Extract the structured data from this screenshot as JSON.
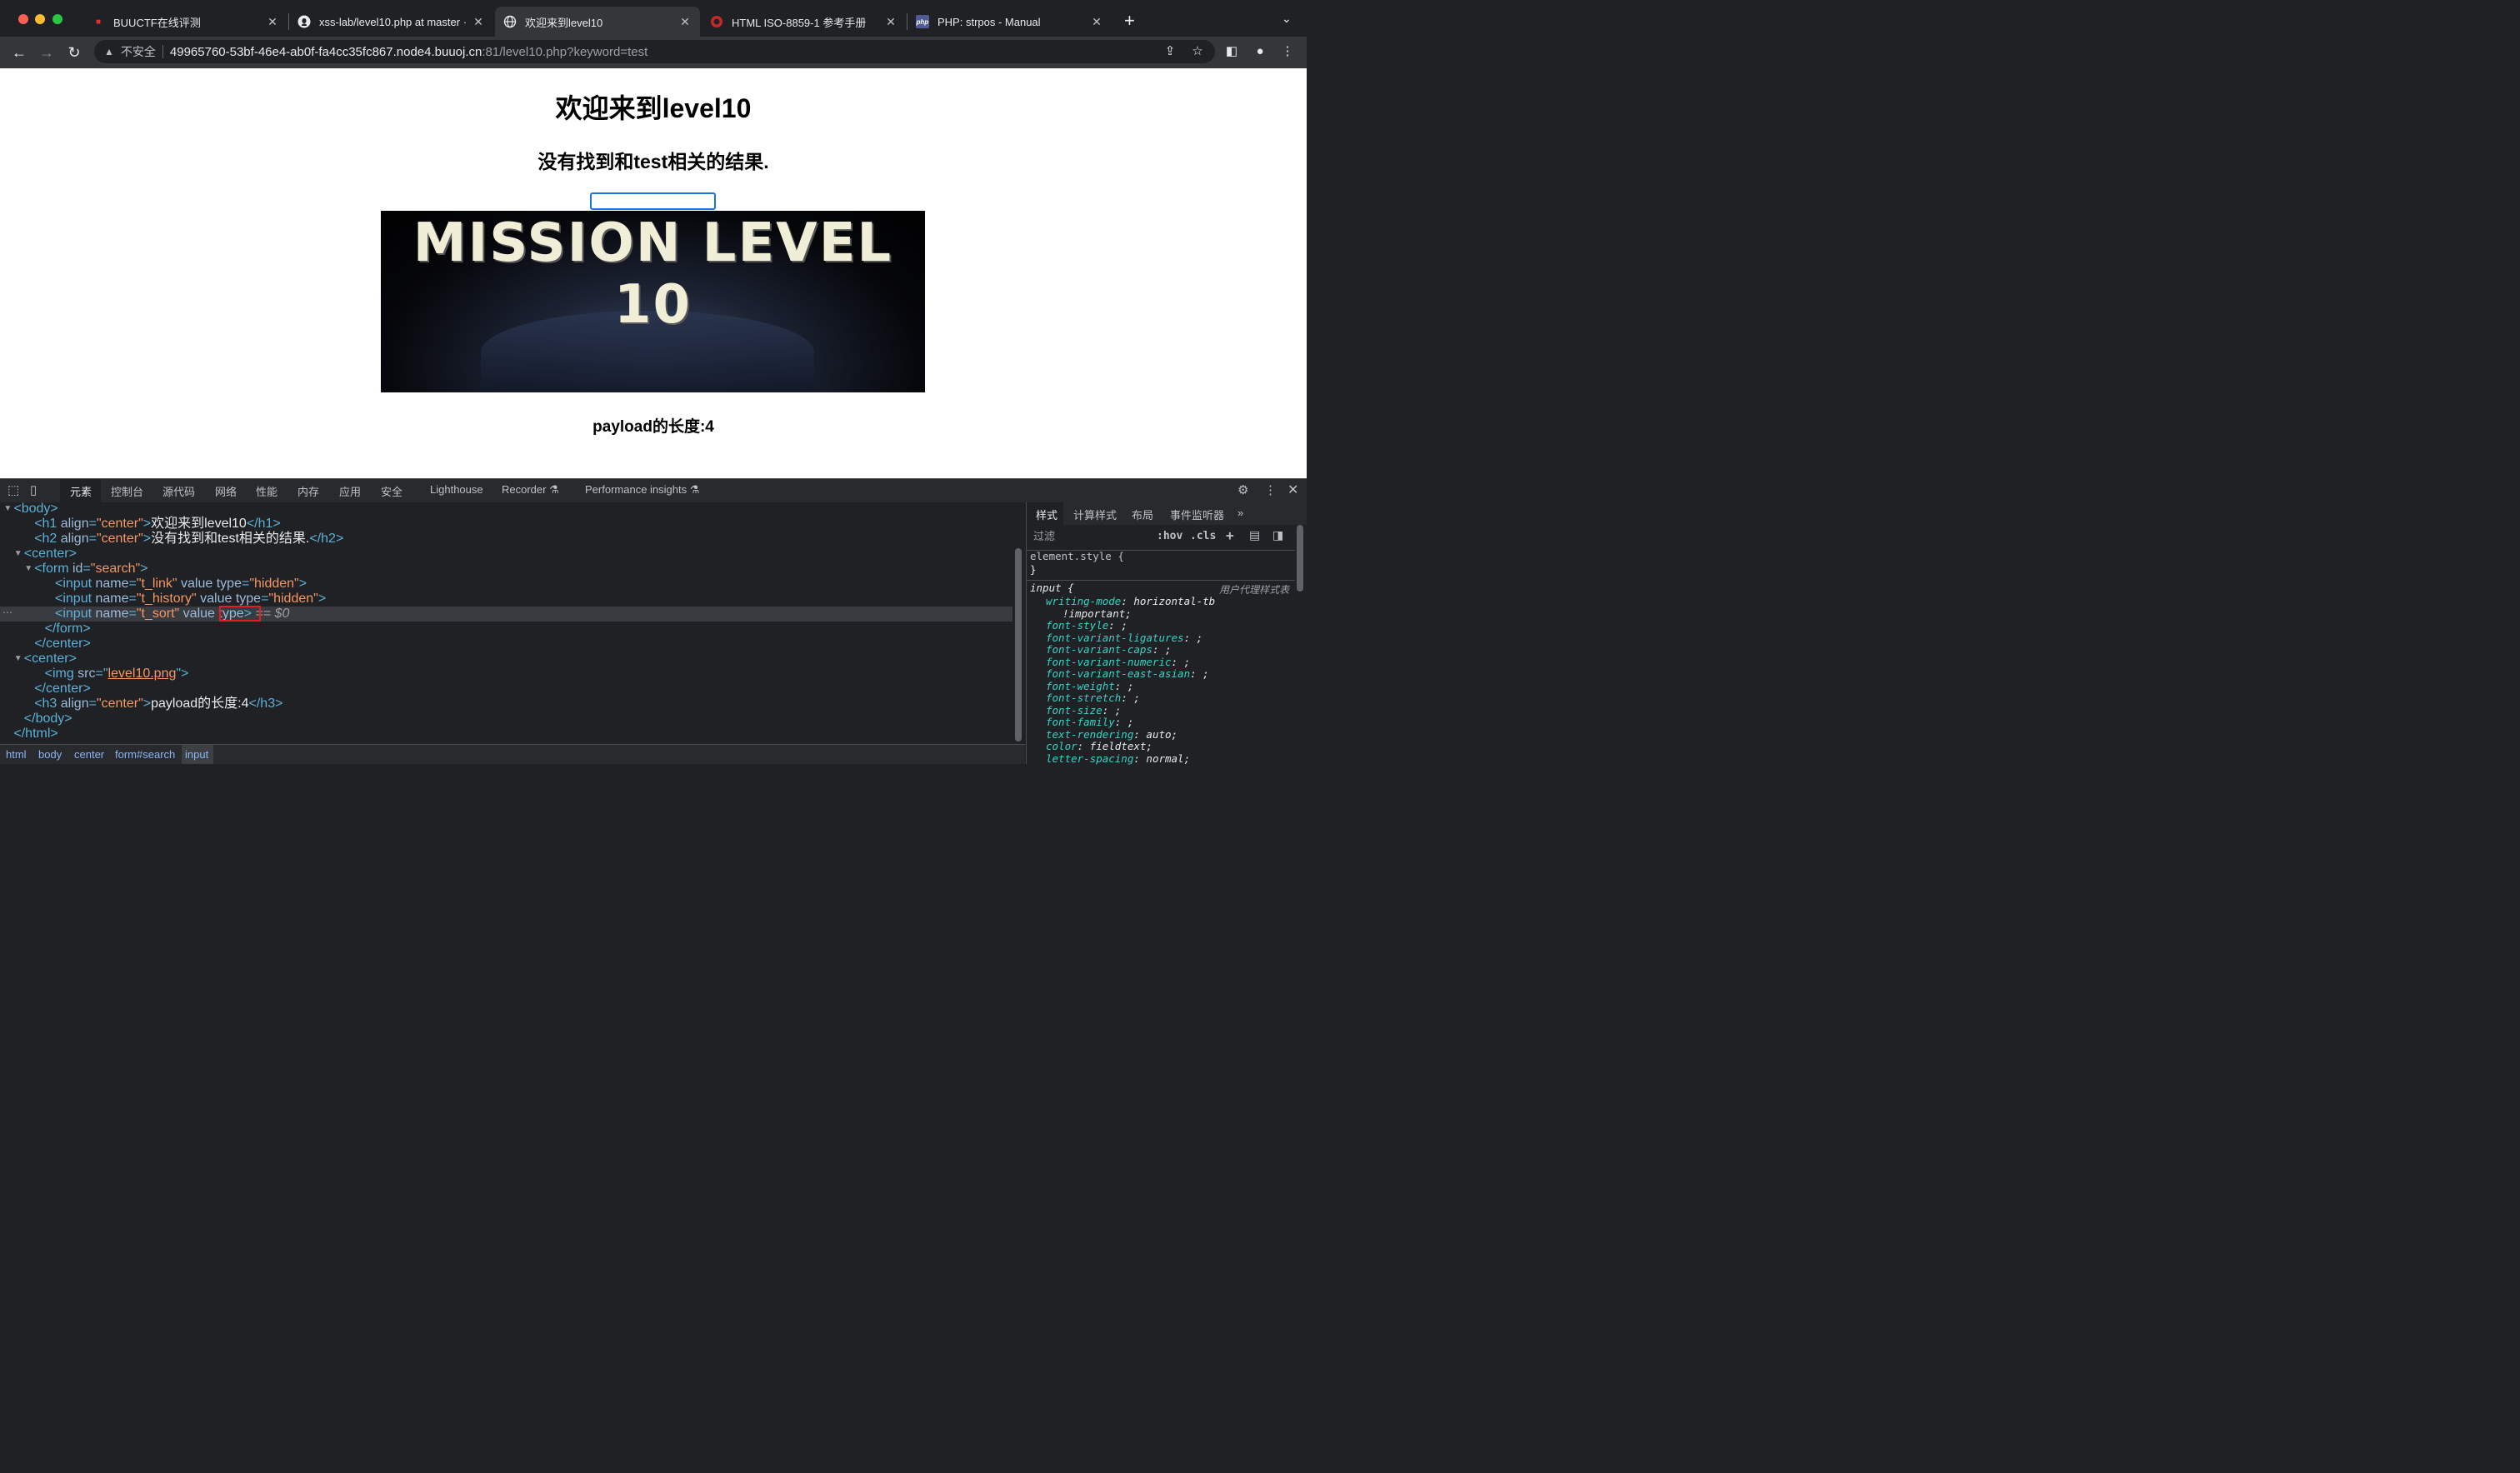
{
  "browser": {
    "tabs": [
      {
        "title": "BUUCTF在线评测",
        "active": false,
        "icon": "buuctf-icon"
      },
      {
        "title": "xss-lab/level10.php at master · ",
        "active": false,
        "icon": "github-icon"
      },
      {
        "title": "欢迎来到level10",
        "active": true,
        "icon": "globe-icon"
      },
      {
        "title": "HTML ISO-8859-1 参考手册",
        "active": false,
        "icon": "w3school-icon"
      },
      {
        "title": "PHP: strpos - Manual",
        "active": false,
        "icon": "php-icon"
      }
    ],
    "new_tab": "+",
    "address": {
      "security": "不安全",
      "host": "49965760-53bf-46e4-ab0f-fa4cc35fc867.node4.buuoj.cn",
      "path": ":81/level10.php?keyword=test"
    }
  },
  "page": {
    "h1": "欢迎来到level10",
    "h2": "没有找到和test相关的结果.",
    "image_text": "MISSION LEVEL 10",
    "h3": "payload的长度:4"
  },
  "devtools": {
    "tabs": [
      "元素",
      "控制台",
      "源代码",
      "网络",
      "性能",
      "内存",
      "应用",
      "安全",
      "Lighthouse",
      "Recorder ⚗",
      "Performance insights ⚗"
    ],
    "dom_lines": [
      {
        "indent": 1,
        "tri": "▼",
        "parts": [
          [
            "tag",
            "<body>"
          ]
        ]
      },
      {
        "indent": 3,
        "tri": "",
        "parts": [
          [
            "tag",
            "<h1 "
          ],
          [
            "attr",
            "align"
          ],
          [
            "tag",
            "="
          ],
          [
            "val",
            "\"center\""
          ],
          [
            "tag",
            ">"
          ],
          [
            "txt",
            "欢迎来到level10"
          ],
          [
            "tag",
            "</h1>"
          ]
        ]
      },
      {
        "indent": 3,
        "tri": "",
        "parts": [
          [
            "tag",
            "<h2 "
          ],
          [
            "attr",
            "align"
          ],
          [
            "tag",
            "="
          ],
          [
            "val",
            "\"center\""
          ],
          [
            "tag",
            ">"
          ],
          [
            "txt",
            "没有找到和test相关的结果."
          ],
          [
            "tag",
            "</h2>"
          ]
        ]
      },
      {
        "indent": 2,
        "tri": "▼",
        "parts": [
          [
            "tag",
            "<center>"
          ]
        ]
      },
      {
        "indent": 3,
        "tri": "▼",
        "parts": [
          [
            "tag",
            "<form "
          ],
          [
            "attr",
            "id"
          ],
          [
            "tag",
            "="
          ],
          [
            "val",
            "\"search\""
          ],
          [
            "tag",
            ">"
          ]
        ]
      },
      {
        "indent": 5,
        "tri": "",
        "parts": [
          [
            "tag",
            "<input "
          ],
          [
            "attr",
            "name"
          ],
          [
            "tag",
            "="
          ],
          [
            "val",
            "\"t_link\""
          ],
          [
            "attr",
            " value type"
          ],
          [
            "tag",
            "="
          ],
          [
            "val",
            "\"hidden\""
          ],
          [
            "tag",
            ">"
          ]
        ]
      },
      {
        "indent": 5,
        "tri": "",
        "parts": [
          [
            "tag",
            "<input "
          ],
          [
            "attr",
            "name"
          ],
          [
            "tag",
            "="
          ],
          [
            "val",
            "\"t_history\""
          ],
          [
            "attr",
            " value type"
          ],
          [
            "tag",
            "="
          ],
          [
            "val",
            "\"hidden\""
          ],
          [
            "tag",
            ">"
          ]
        ]
      },
      {
        "indent": 5,
        "tri": "",
        "parts": [
          [
            "tag",
            "<input "
          ],
          [
            "attr",
            "name"
          ],
          [
            "tag",
            "="
          ],
          [
            "val",
            "\"t_sort\""
          ],
          [
            "attr",
            " value "
          ],
          [
            "attr",
            "type"
          ],
          [
            "tag",
            "> "
          ],
          [
            "txt",
            "== $0"
          ]
        ]
      },
      {
        "indent": 4,
        "tri": "",
        "parts": [
          [
            "tag",
            "</form>"
          ]
        ]
      },
      {
        "indent": 3,
        "tri": "",
        "parts": [
          [
            "tag",
            "</center>"
          ]
        ]
      },
      {
        "indent": 2,
        "tri": "▼",
        "parts": [
          [
            "tag",
            "<center>"
          ]
        ]
      },
      {
        "indent": 4,
        "tri": "",
        "parts": [
          [
            "tag",
            "<img "
          ],
          [
            "attr",
            "src"
          ],
          [
            "tag",
            "="
          ],
          [
            "tag",
            "\""
          ],
          [
            "val",
            "level10.png"
          ],
          [
            "tag",
            "\">"
          ]
        ]
      },
      {
        "indent": 3,
        "tri": "",
        "parts": [
          [
            "tag",
            "</center>"
          ]
        ]
      },
      {
        "indent": 3,
        "tri": "",
        "parts": [
          [
            "tag",
            "<h3 "
          ],
          [
            "attr",
            "align"
          ],
          [
            "tag",
            "="
          ],
          [
            "val",
            "\"center\""
          ],
          [
            "tag",
            ">"
          ],
          [
            "txt",
            "payload的长度:4"
          ],
          [
            "tag",
            "</h3>"
          ]
        ]
      },
      {
        "indent": 2,
        "tri": "",
        "parts": [
          [
            "tag",
            "</body>"
          ]
        ]
      },
      {
        "indent": 1,
        "tri": "",
        "parts": [
          [
            "tag",
            "</html>"
          ]
        ]
      }
    ],
    "breadcrumbs": [
      "html",
      "body",
      "center",
      "form#search",
      "input"
    ],
    "styles_tabs": [
      "样式",
      "计算样式",
      "布局",
      "事件监听器",
      "»"
    ],
    "filter_placeholder": "过滤",
    "filter_buttons": [
      ":hov",
      ".cls",
      "+"
    ],
    "ua_label": "用户代理样式表",
    "style_lines": [
      {
        "k": "sel",
        "t": "element.style {"
      },
      {
        "k": "sel",
        "t": "}"
      },
      {
        "k": "sel",
        "t": "input {"
      },
      {
        "k": "prop",
        "p": "writing-mode",
        "v": "horizontal-tb"
      },
      {
        "k": "cont",
        "t": "!important;"
      },
      {
        "k": "prop",
        "p": "font-style",
        "v": ";"
      },
      {
        "k": "prop",
        "p": "font-variant-ligatures",
        "v": ";"
      },
      {
        "k": "prop",
        "p": "font-variant-caps",
        "v": ";"
      },
      {
        "k": "prop",
        "p": "font-variant-numeric",
        "v": ";"
      },
      {
        "k": "prop",
        "p": "font-variant-east-asian",
        "v": ";"
      },
      {
        "k": "prop",
        "p": "font-weight",
        "v": ";"
      },
      {
        "k": "prop",
        "p": "font-stretch",
        "v": ";"
      },
      {
        "k": "prop",
        "p": "font-size",
        "v": ";"
      },
      {
        "k": "prop",
        "p": "font-family",
        "v": ";"
      },
      {
        "k": "prop",
        "p": "text-rendering",
        "v": "auto;"
      },
      {
        "k": "prop",
        "p": "color",
        "v": "fieldtext;"
      },
      {
        "k": "prop",
        "p": "letter-spacing",
        "v": "normal;"
      }
    ]
  }
}
